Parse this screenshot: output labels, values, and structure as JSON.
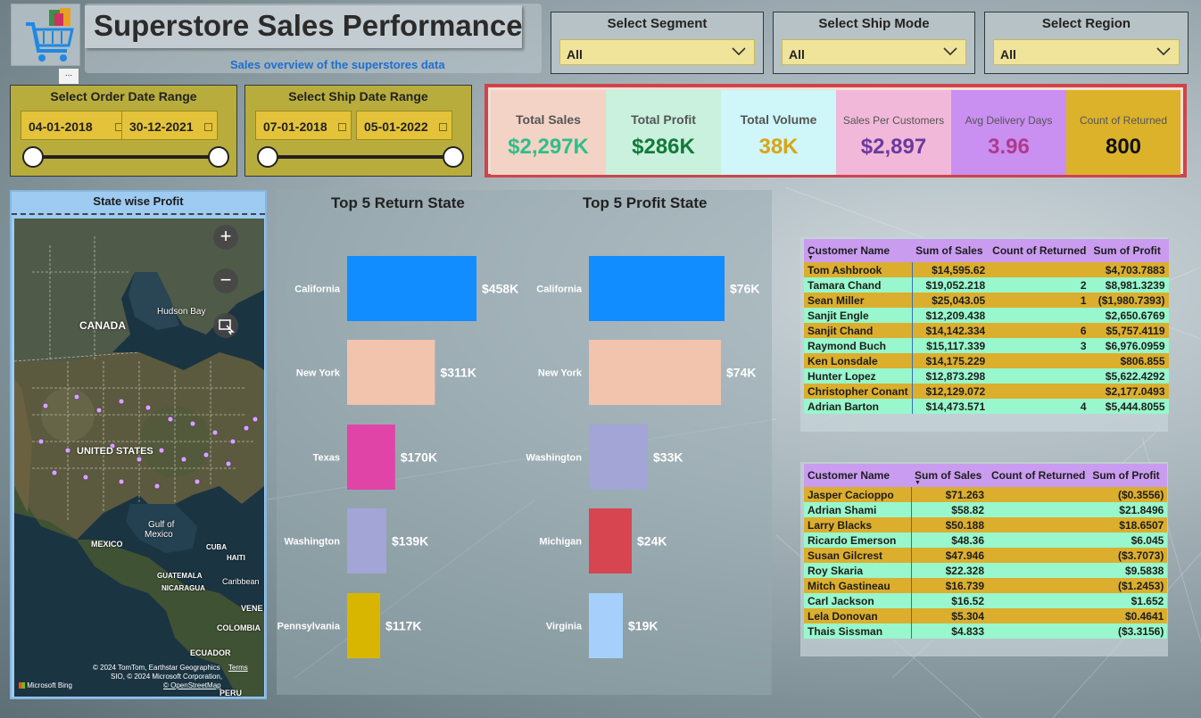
{
  "header": {
    "title": "Superstore Sales Performance",
    "subtitle": "Sales overview of the superstores data",
    "more_label": "..."
  },
  "filters": {
    "segment": {
      "label": "Select Segment",
      "value": "All"
    },
    "ship_mode": {
      "label": "Select Ship Mode",
      "value": "All"
    },
    "region": {
      "label": "Select Region",
      "value": "All"
    },
    "order_date": {
      "label": "Select Order Date Range",
      "start": "04-01-2018",
      "end": "30-12-2021"
    },
    "ship_date": {
      "label": "Select Ship Date Range",
      "start": "07-01-2018",
      "end": "05-01-2022"
    }
  },
  "kpis": [
    {
      "label": "Total Sales",
      "value": "$2,297K",
      "bg": "#f3d3c6",
      "color": "#2fbf8a"
    },
    {
      "label": "Total Profit",
      "value": "$286K",
      "bg": "#c9f1dd",
      "color": "#137a3b"
    },
    {
      "label": "Total Volume",
      "value": "38K",
      "bg": "#cff6f8",
      "color": "#d9a516"
    },
    {
      "label": "Sales Per Customers",
      "value": "$2,897",
      "bg": "#f1b8da",
      "color": "#6a3a9b"
    },
    {
      "label": "Avg Delivery Days",
      "value": "3.96",
      "bg": "#c98ff1",
      "color": "#b03a8e"
    },
    {
      "label": "Count of Returned",
      "value": "800",
      "bg": "#dcb22a",
      "color": "#111111"
    }
  ],
  "map": {
    "title": "State wise Profit",
    "labels": {
      "canada": "CANADA",
      "hudson_bay": "Hudson Bay",
      "united_states": "UNITED STATES",
      "gulf": "Gulf of",
      "gulf2": "Mexico",
      "mexico": "MEXICO",
      "cuba": "CUBA",
      "haiti": "HAITI",
      "guatemala": "GUATEMALA",
      "nicaragua": "NICARAGUA",
      "caribbean": "Caribbean",
      "vene": "VENE",
      "colombia": "COLOMBIA",
      "ecuador": "ECUADOR",
      "peru": "PERU"
    },
    "attribution_1": "© 2024 TomTom, Earthstar Geographics",
    "attribution_terms": "Terms",
    "attribution_2": "SIO, © 2024 Microsoft Corporation,",
    "attribution_3": "© OpenStreetMap",
    "bing_label": "Microsoft Bing"
  },
  "chart_data": [
    {
      "type": "bar",
      "title": "Top 5 Return State",
      "orientation": "horizontal",
      "categories": [
        "California",
        "New York",
        "Texas",
        "Washington",
        "Pennsylvania"
      ],
      "values": [
        458,
        311,
        170,
        139,
        117
      ],
      "data_labels": [
        "$458K",
        "$311K",
        "$170K",
        "$139K",
        "$117K"
      ],
      "colors": [
        "#118dff",
        "#f2c3ad",
        "#e044a7",
        "#a2a5d6",
        "#d8b600"
      ],
      "unit": "$K"
    },
    {
      "type": "bar",
      "title": "Top 5 Profit State",
      "orientation": "horizontal",
      "categories": [
        "California",
        "New York",
        "Washington",
        "Michigan",
        "Virginia"
      ],
      "values": [
        76,
        74,
        33,
        24,
        19
      ],
      "data_labels": [
        "$76K",
        "$74K",
        "$33K",
        "$24K",
        "$19K"
      ],
      "colors": [
        "#118dff",
        "#f2c3ad",
        "#a2a5d6",
        "#d64550",
        "#a6d0fb"
      ],
      "unit": "$K"
    }
  ],
  "table_top": {
    "headers": [
      "Customer Name",
      "Sum of Sales",
      "Count of Returned",
      "Sum of Profit"
    ],
    "rows": [
      [
        "Tom Ashbrook",
        "$14,595.62",
        "",
        "$4,703.7883"
      ],
      [
        "Tamara Chand",
        "$19,052.218",
        "2",
        "$8,981.3239"
      ],
      [
        "Sean Miller",
        "$25,043.05",
        "1",
        "($1,980.7393)"
      ],
      [
        "Sanjit Engle",
        "$12,209.438",
        "",
        "$2,650.6769"
      ],
      [
        "Sanjit Chand",
        "$14,142.334",
        "6",
        "$5,757.4119"
      ],
      [
        "Raymond Buch",
        "$15,117.339",
        "3",
        "$6,976.0959"
      ],
      [
        "Ken Lonsdale",
        "$14,175.229",
        "",
        "$806.855"
      ],
      [
        "Hunter Lopez",
        "$12,873.298",
        "",
        "$5,622.4292"
      ],
      [
        "Christopher Conant",
        "$12,129.072",
        "",
        "$2,177.0493"
      ],
      [
        "Adrian Barton",
        "$14,473.571",
        "4",
        "$5,444.8055"
      ]
    ]
  },
  "table_bottom": {
    "headers": [
      "Customer Name",
      "Sum of Sales",
      "Count of Returned",
      "Sum of Profit"
    ],
    "rows": [
      [
        "Jasper Cacioppo",
        "$71.263",
        "",
        "($0.3556)"
      ],
      [
        "Adrian Shami",
        "$58.82",
        "",
        "$21.8496"
      ],
      [
        "Larry Blacks",
        "$50.188",
        "",
        "$18.6507"
      ],
      [
        "Ricardo Emerson",
        "$48.36",
        "",
        "$6.045"
      ],
      [
        "Susan Gilcrest",
        "$47.946",
        "",
        "($3.7073)"
      ],
      [
        "Roy Skaria",
        "$22.328",
        "",
        "$9.5838"
      ],
      [
        "Mitch Gastineau",
        "$16.739",
        "",
        "($1.2453)"
      ],
      [
        "Carl Jackson",
        "$16.52",
        "",
        "$1.652"
      ],
      [
        "Lela Donovan",
        "$5.304",
        "",
        "$0.4641"
      ],
      [
        "Thais Sissman",
        "$4.833",
        "",
        "($3.3156)"
      ]
    ]
  }
}
